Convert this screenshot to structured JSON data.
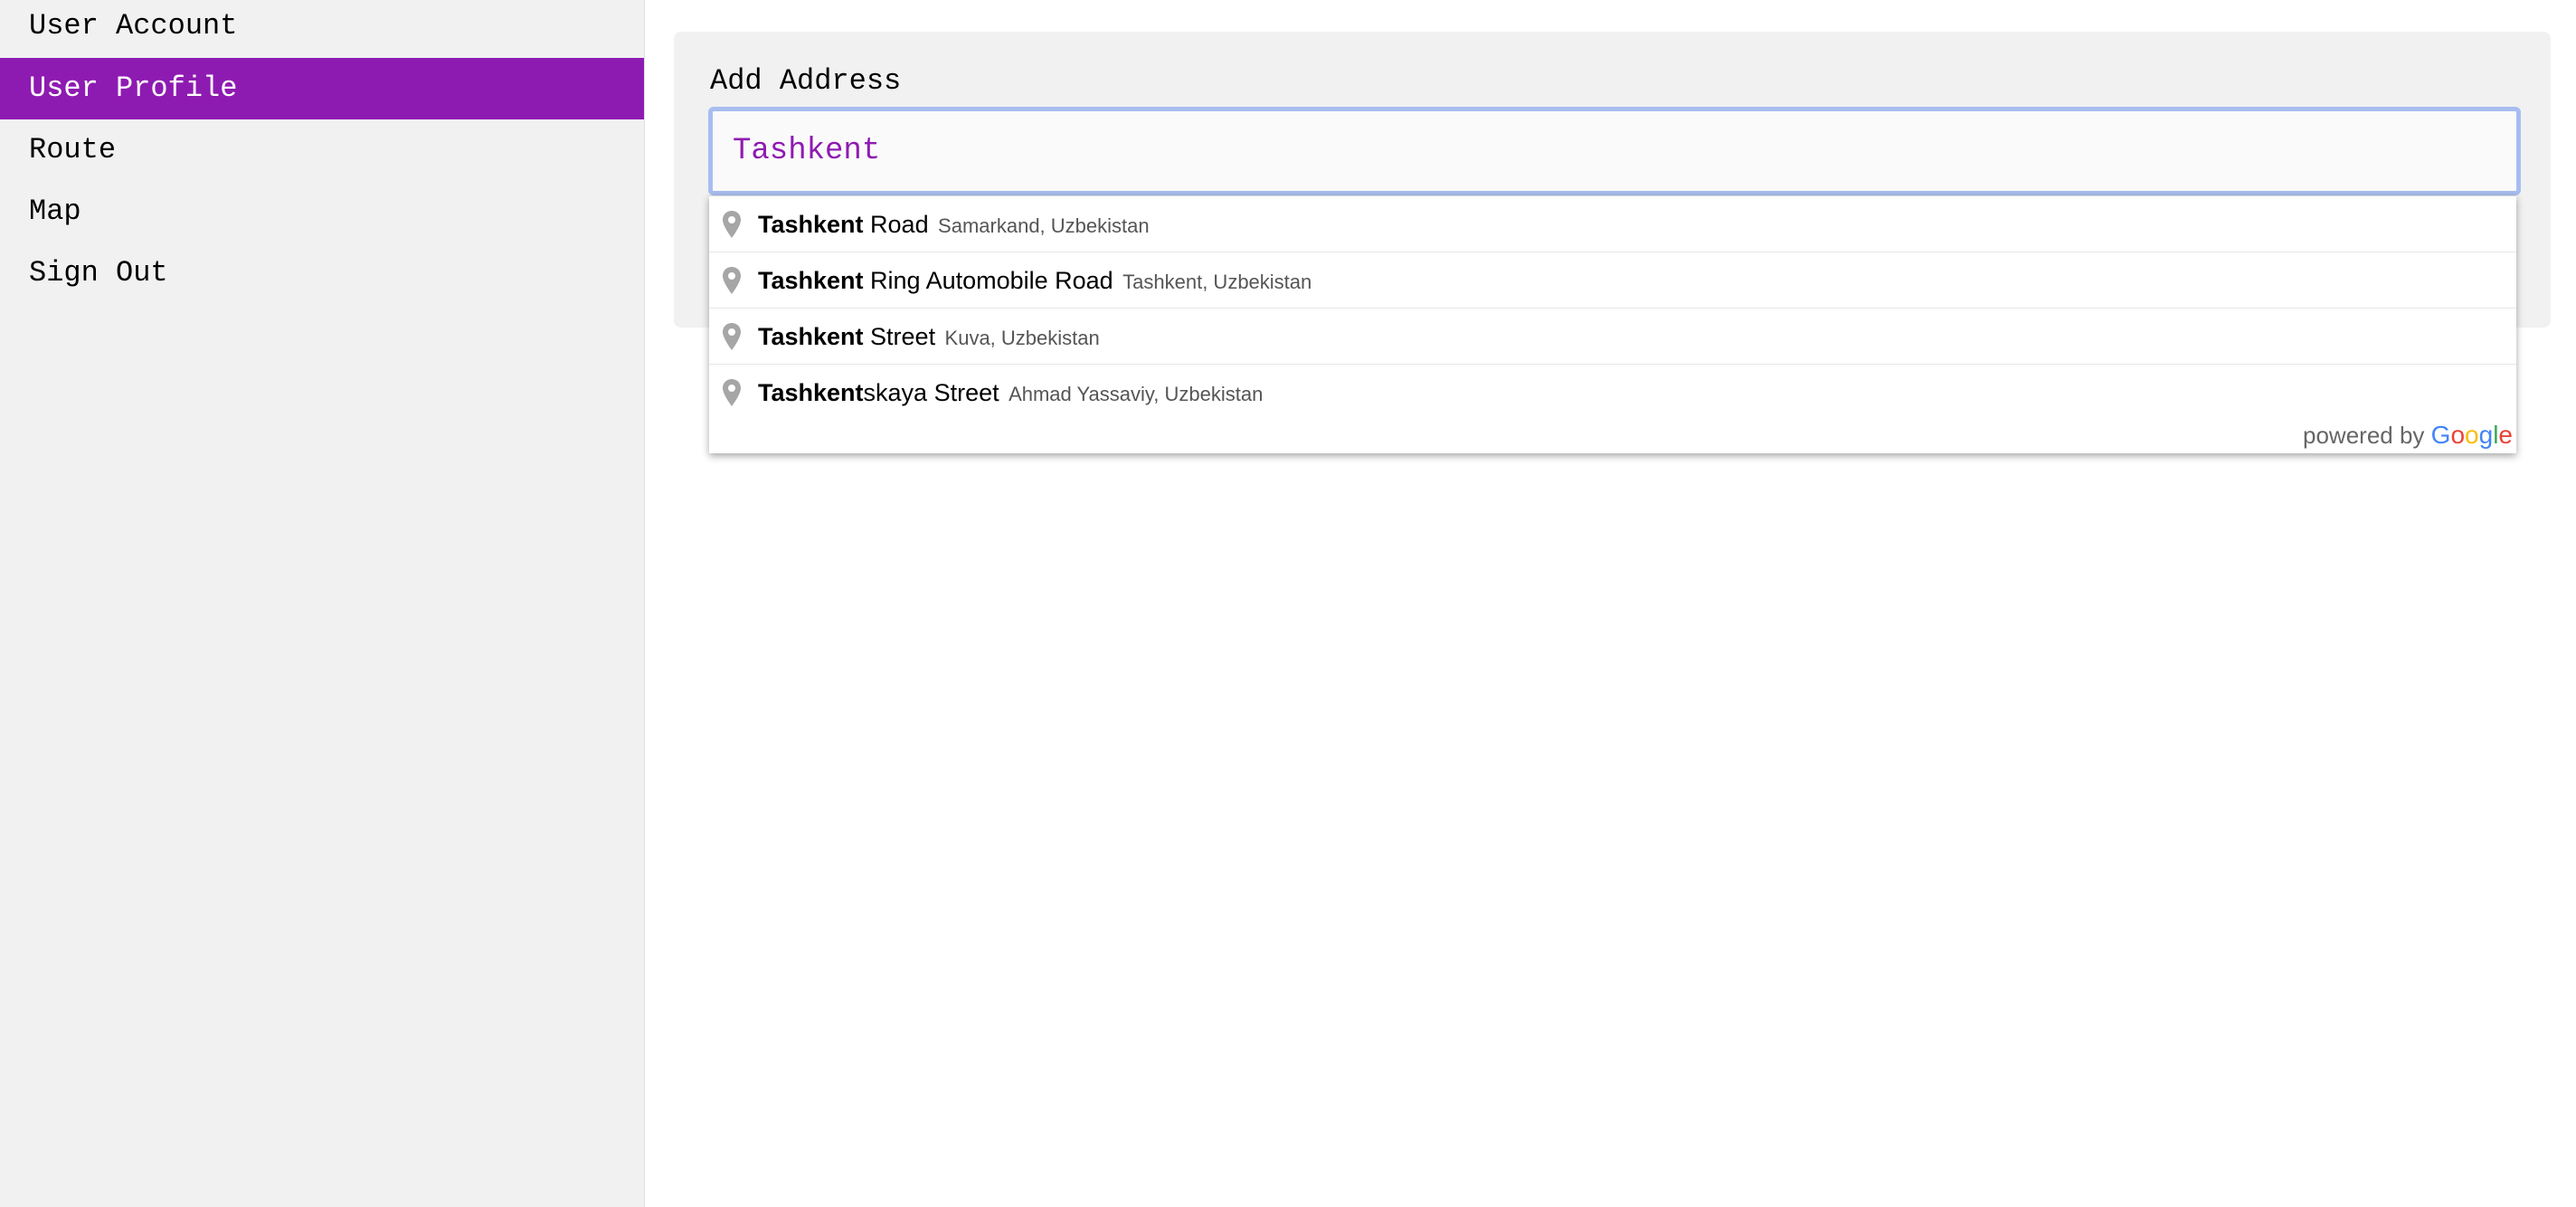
{
  "sidebar": {
    "items": [
      {
        "label": "User Account",
        "active": false
      },
      {
        "label": "User Profile",
        "active": true
      },
      {
        "label": "Route",
        "active": false
      },
      {
        "label": "Map",
        "active": false
      },
      {
        "label": "Sign Out",
        "active": false
      }
    ]
  },
  "main": {
    "title": "Add Address",
    "address_input": {
      "value": "Tashkent"
    }
  },
  "autocomplete": {
    "suggestions": [
      {
        "match": "Tashkent",
        "rest": " Road",
        "secondary": "Samarkand, Uzbekistan",
        "icon": "map-pin-icon"
      },
      {
        "match": "Tashkent",
        "rest": " Ring Automobile Road",
        "secondary": "Tashkent, Uzbekistan",
        "icon": "map-pin-icon"
      },
      {
        "match": "Tashkent",
        "rest": " Street",
        "secondary": "Kuva, Uzbekistan",
        "icon": "map-pin-icon"
      },
      {
        "match": "Tashkent",
        "rest": "skaya Street",
        "secondary": "Ahmad Yassaviy, Uzbekistan",
        "icon": "map-pin-icon"
      }
    ],
    "powered_by": "powered by",
    "logo_text": "Google"
  },
  "colors": {
    "accent": "#8e1bb1",
    "input_focus_border": "#a8bdf0",
    "panel_background": "#f1f1f1"
  }
}
